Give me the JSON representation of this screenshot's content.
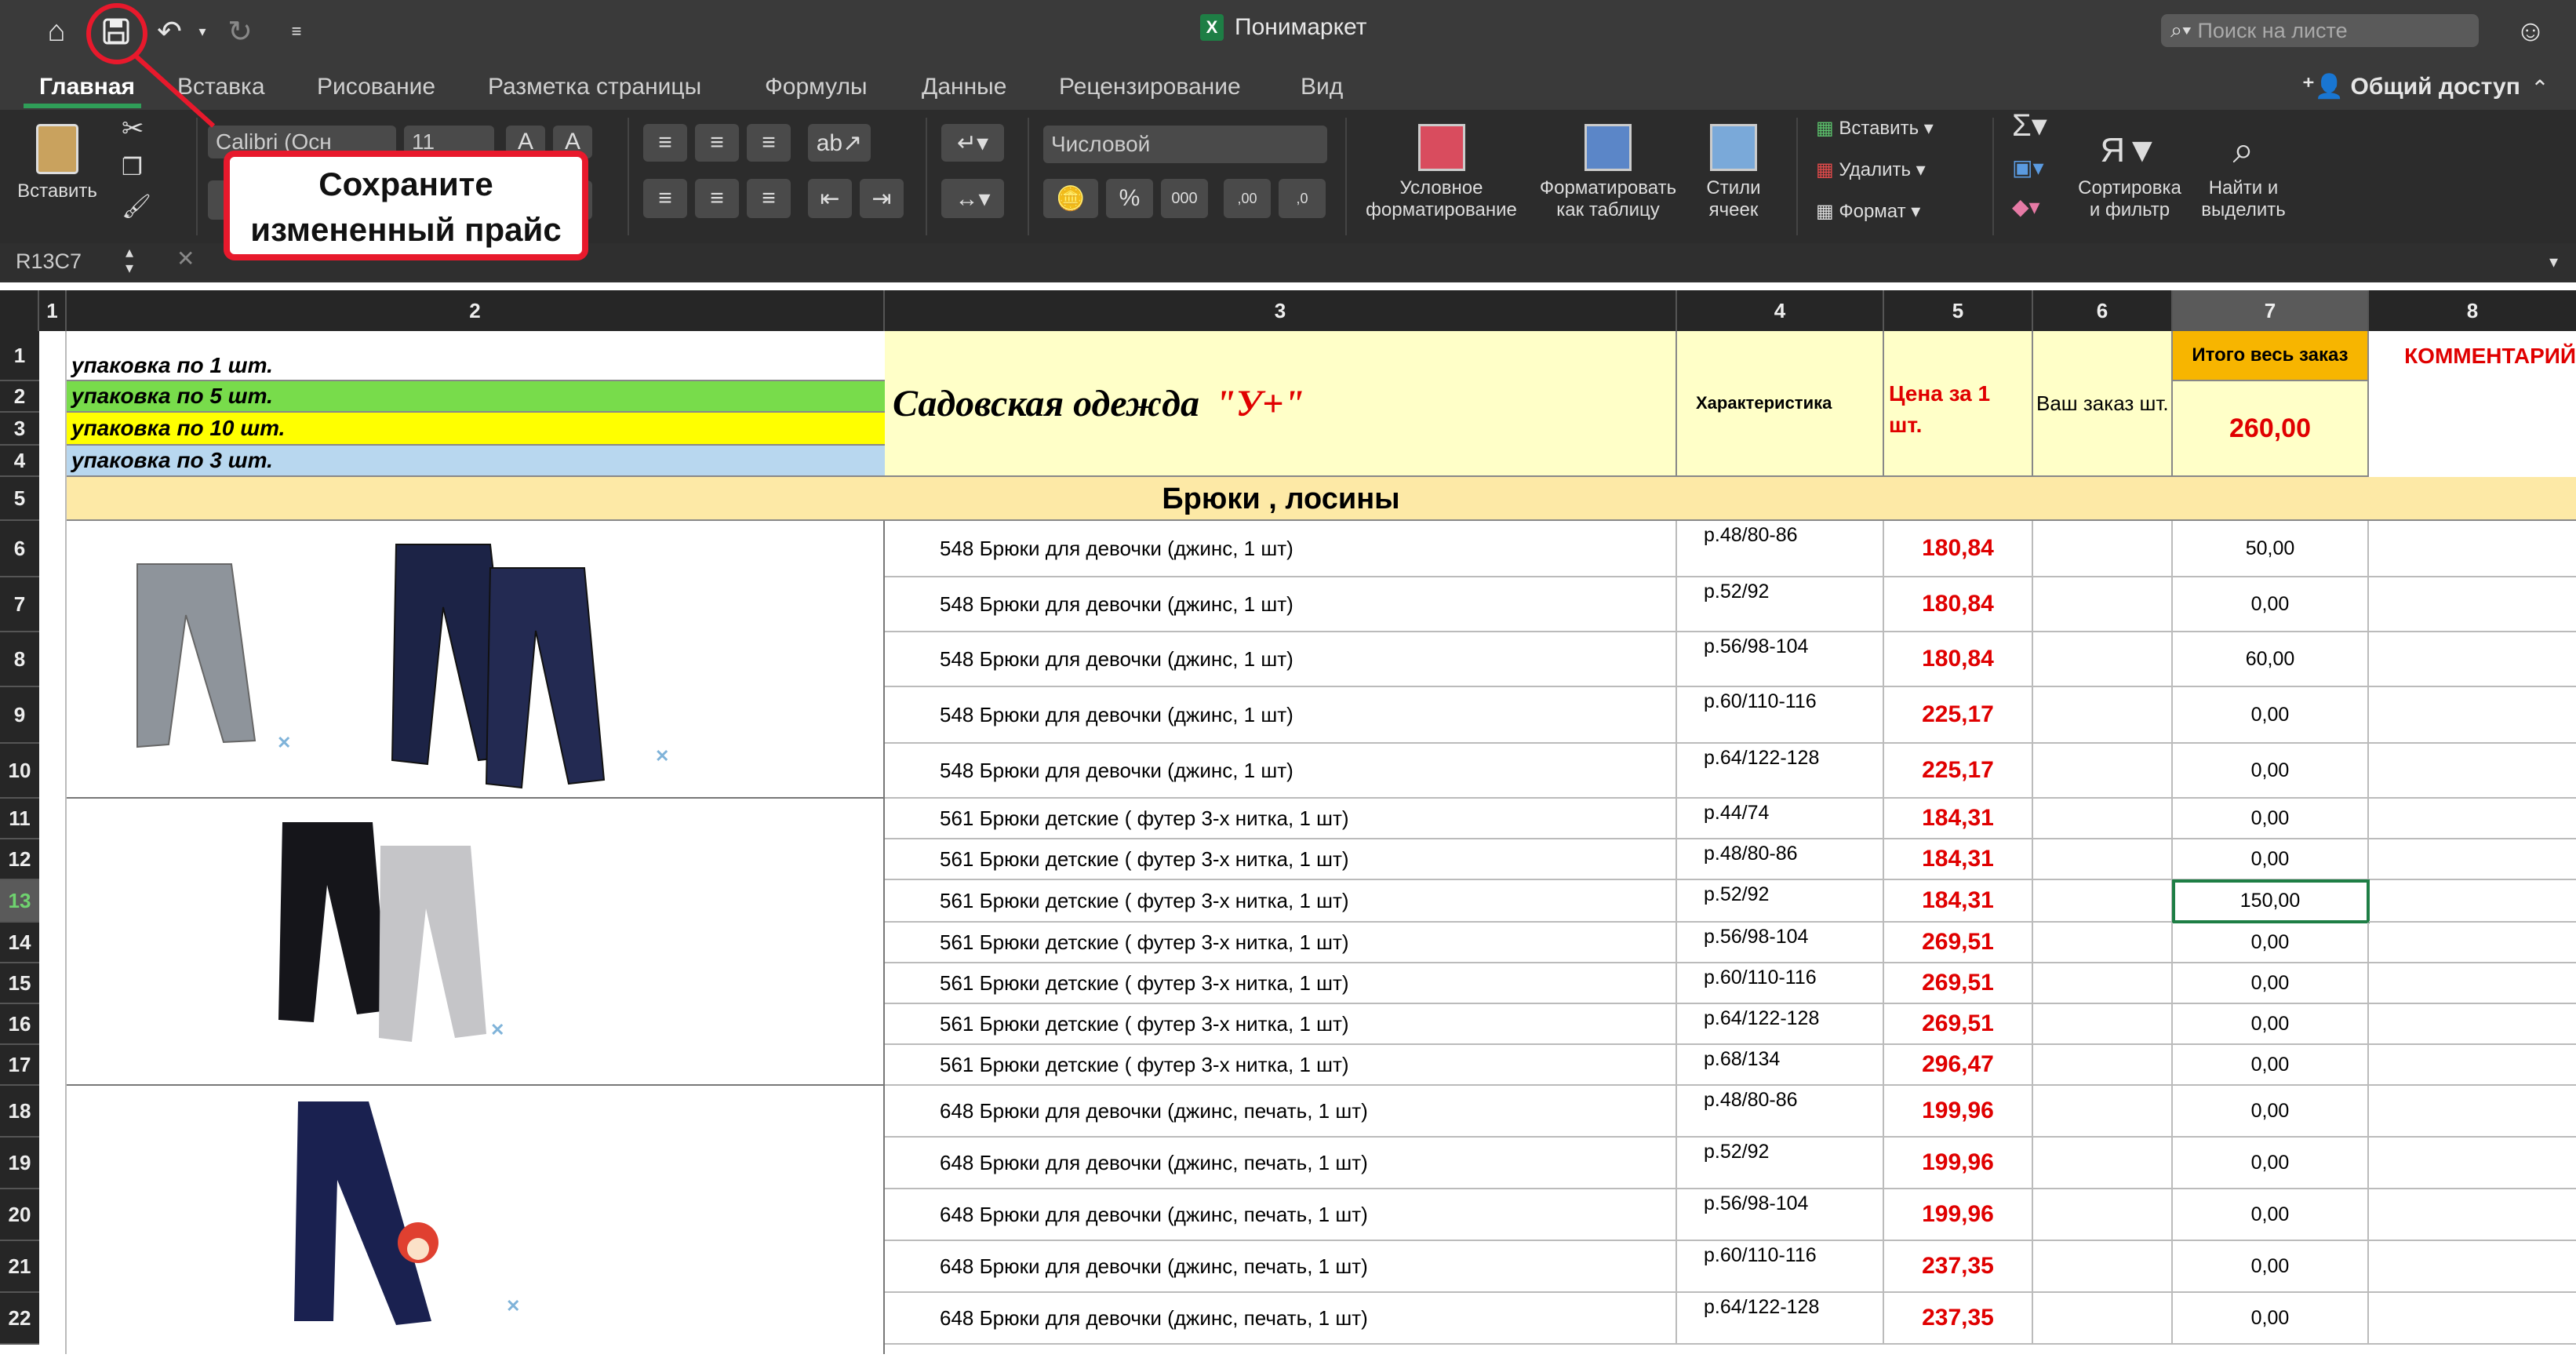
{
  "window": {
    "title": "Понимаркет",
    "search_placeholder": "Поиск на листе"
  },
  "tabs": [
    {
      "label": "Главная",
      "active": true
    },
    {
      "label": "Вставка"
    },
    {
      "label": "Рисование"
    },
    {
      "label": "Разметка страницы"
    },
    {
      "label": "Формулы"
    },
    {
      "label": "Данные"
    },
    {
      "label": "Рецензирование"
    },
    {
      "label": "Вид"
    }
  ],
  "share_label": "Общий доступ",
  "ribbon": {
    "paste": "Вставить",
    "font_name": "Calibri (Осн",
    "font_size": "11",
    "number_format": "Числовой",
    "cond_format": "Условное форматирование",
    "format_table": "Форматировать как таблицу",
    "cell_styles": "Стили ячеек",
    "insert": "Вставить",
    "delete": "Удалить",
    "format": "Формат",
    "sort_filter": "Сортировка и фильтр",
    "find_select": "Найти и выделить"
  },
  "namebox": "R13C7",
  "callout": {
    "line1": "Сохраните",
    "line2": "измененный прайс"
  },
  "col_headers": [
    "1",
    "2",
    "3",
    "4",
    "5",
    "6",
    "7",
    "8"
  ],
  "row_headers": [
    "1",
    "2",
    "3",
    "4",
    "5",
    "6",
    "7",
    "8",
    "9",
    "10",
    "11",
    "12",
    "13",
    "14",
    "15",
    "16",
    "17",
    "18",
    "19",
    "20",
    "21",
    "22"
  ],
  "legend": [
    {
      "text": "упаковка по 1 шт.",
      "color": "#ffffff"
    },
    {
      "text": "упаковка по 5 шт.",
      "color": "#78dc4b"
    },
    {
      "text": "упаковка по 10 шт.",
      "color": "#ffff00"
    },
    {
      "text": "упаковка по 3 шт.",
      "color": "#b8d7ef"
    }
  ],
  "header": {
    "title": "Садовская одежда",
    "brand": "\"У+\"",
    "characteristic": "Характеристика",
    "price": "Цена      за 1 шт.",
    "your_order": "Ваш заказ шт.",
    "total_label": "Итого весь заказ",
    "total_value": "260,00",
    "comment": "КОММЕНТАРИЙ"
  },
  "section": "Брюки , лосины",
  "rows": [
    {
      "name": "548 Брюки для девочки (джинс, 1 шт)",
      "size": "р.48/80-86",
      "price": "180,84",
      "total": "50,00"
    },
    {
      "name": "548 Брюки для девочки (джинс, 1 шт)",
      "size": "р.52/92",
      "price": "180,84",
      "total": "0,00"
    },
    {
      "name": "548 Брюки для девочки (джинс, 1 шт)",
      "size": "р.56/98-104",
      "price": "180,84",
      "total": "60,00"
    },
    {
      "name": "548 Брюки для девочки (джинс, 1 шт)",
      "size": "р.60/110-116",
      "price": "225,17",
      "total": "0,00"
    },
    {
      "name": "548 Брюки для девочки (джинс, 1 шт)",
      "size": "р.64/122-128",
      "price": "225,17",
      "total": "0,00"
    },
    {
      "name": "561 Брюки детские ( футер 3-х нитка, 1 шт)",
      "size": "р.44/74",
      "price": "184,31",
      "total": "0,00"
    },
    {
      "name": "561 Брюки детские ( футер 3-х нитка, 1 шт)",
      "size": "р.48/80-86",
      "price": "184,31",
      "total": "0,00"
    },
    {
      "name": "561 Брюки детские ( футер 3-х нитка, 1 шт)",
      "size": "р.52/92",
      "price": "184,31",
      "total": "150,00"
    },
    {
      "name": "561 Брюки детские ( футер 3-х нитка, 1 шт)",
      "size": "р.56/98-104",
      "price": "269,51",
      "total": "0,00"
    },
    {
      "name": "561 Брюки детские ( футер 3-х нитка, 1 шт)",
      "size": "р.60/110-116",
      "price": "269,51",
      "total": "0,00"
    },
    {
      "name": "561 Брюки детские ( футер 3-х нитка, 1 шт)",
      "size": "р.64/122-128",
      "price": "269,51",
      "total": "0,00"
    },
    {
      "name": "561 Брюки детские ( футер 3-х нитка, 1 шт)",
      "size": "р.68/134",
      "price": "296,47",
      "total": "0,00"
    },
    {
      "name": "648 Брюки для девочки (джинс, печать, 1 шт)",
      "size": "р.48/80-86",
      "price": "199,96",
      "total": "0,00"
    },
    {
      "name": "648 Брюки для девочки (джинс, печать, 1 шт)",
      "size": "р.52/92",
      "price": "199,96",
      "total": "0,00"
    },
    {
      "name": "648 Брюки для девочки (джинс, печать, 1 шт)",
      "size": "р.56/98-104",
      "price": "199,96",
      "total": "0,00"
    },
    {
      "name": "648 Брюки для девочки (джинс, печать, 1 шт)",
      "size": "р.60/110-116",
      "price": "237,35",
      "total": "0,00"
    },
    {
      "name": "648 Брюки для девочки (джинс, печать, 1 шт)",
      "size": "р.64/122-128",
      "price": "237,35",
      "total": "0,00"
    }
  ]
}
